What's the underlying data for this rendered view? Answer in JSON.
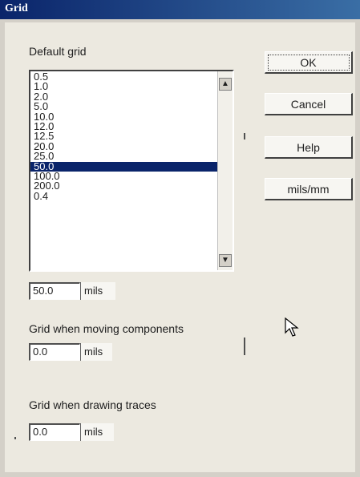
{
  "window": {
    "title": "Grid"
  },
  "default_grid": {
    "label": "Default grid",
    "items": [
      "0.5",
      "1.0",
      "2.0",
      "5.0",
      "10.0",
      "12.0",
      "12.5",
      "20.0",
      "25.0",
      "50.0",
      "100.0",
      "200.0",
      "0.4"
    ],
    "selected_index": 9,
    "value": "50.0",
    "unit": "mils"
  },
  "moving_grid": {
    "label": "Grid when moving components",
    "value": "0.0",
    "unit": "mils"
  },
  "drawing_grid": {
    "label": "Grid when drawing traces",
    "value": "0.0",
    "unit": "mils"
  },
  "buttons": {
    "ok": "OK",
    "cancel": "Cancel",
    "help": "Help",
    "units": "mils/mm"
  },
  "colors": {
    "titlebar": "#0a246a",
    "selection": "#0a246a",
    "face": "#d4d0c8"
  }
}
